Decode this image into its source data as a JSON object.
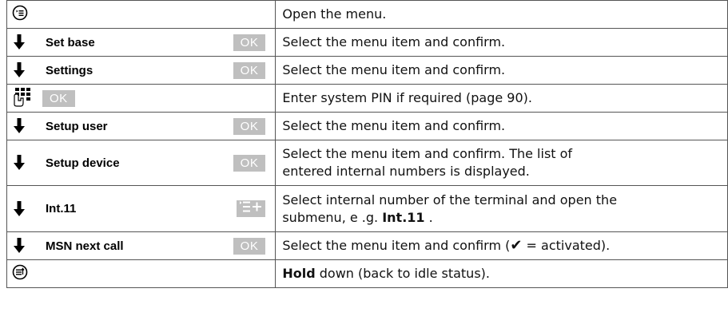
{
  "rows": [
    {
      "desc": "Open the menu."
    },
    {
      "item": "Set base",
      "ok": "OK",
      "desc": "Select the menu item and confirm."
    },
    {
      "item": "Settings",
      "ok": "OK",
      "desc": "Select the menu item and confirm."
    },
    {
      "ok": "OK",
      "desc": "Enter system PIN if required (page 90)."
    },
    {
      "item": "Setup user",
      "ok": "OK",
      "desc": "Select the menu item and confirm."
    },
    {
      "item": "Setup device",
      "ok": "OK",
      "desc_line1": "Select the menu item and confirm. The list of",
      "desc_line2": "entered internal numbers is displayed."
    },
    {
      "item": "Int.11",
      "desc_line1": "Select internal number of the terminal and open the",
      "desc_line2_pre": "submenu, e .g. ",
      "desc_line2_bold": "Int.11",
      "desc_line2_post": " ."
    },
    {
      "item": "MSN next call",
      "ok": "OK",
      "desc_pre": "Select the menu item and confirm (",
      "desc_check": "✔",
      "desc_post": " = activated)."
    },
    {
      "desc_bold": "Hold",
      "desc_post": " down (back to idle status)."
    }
  ]
}
